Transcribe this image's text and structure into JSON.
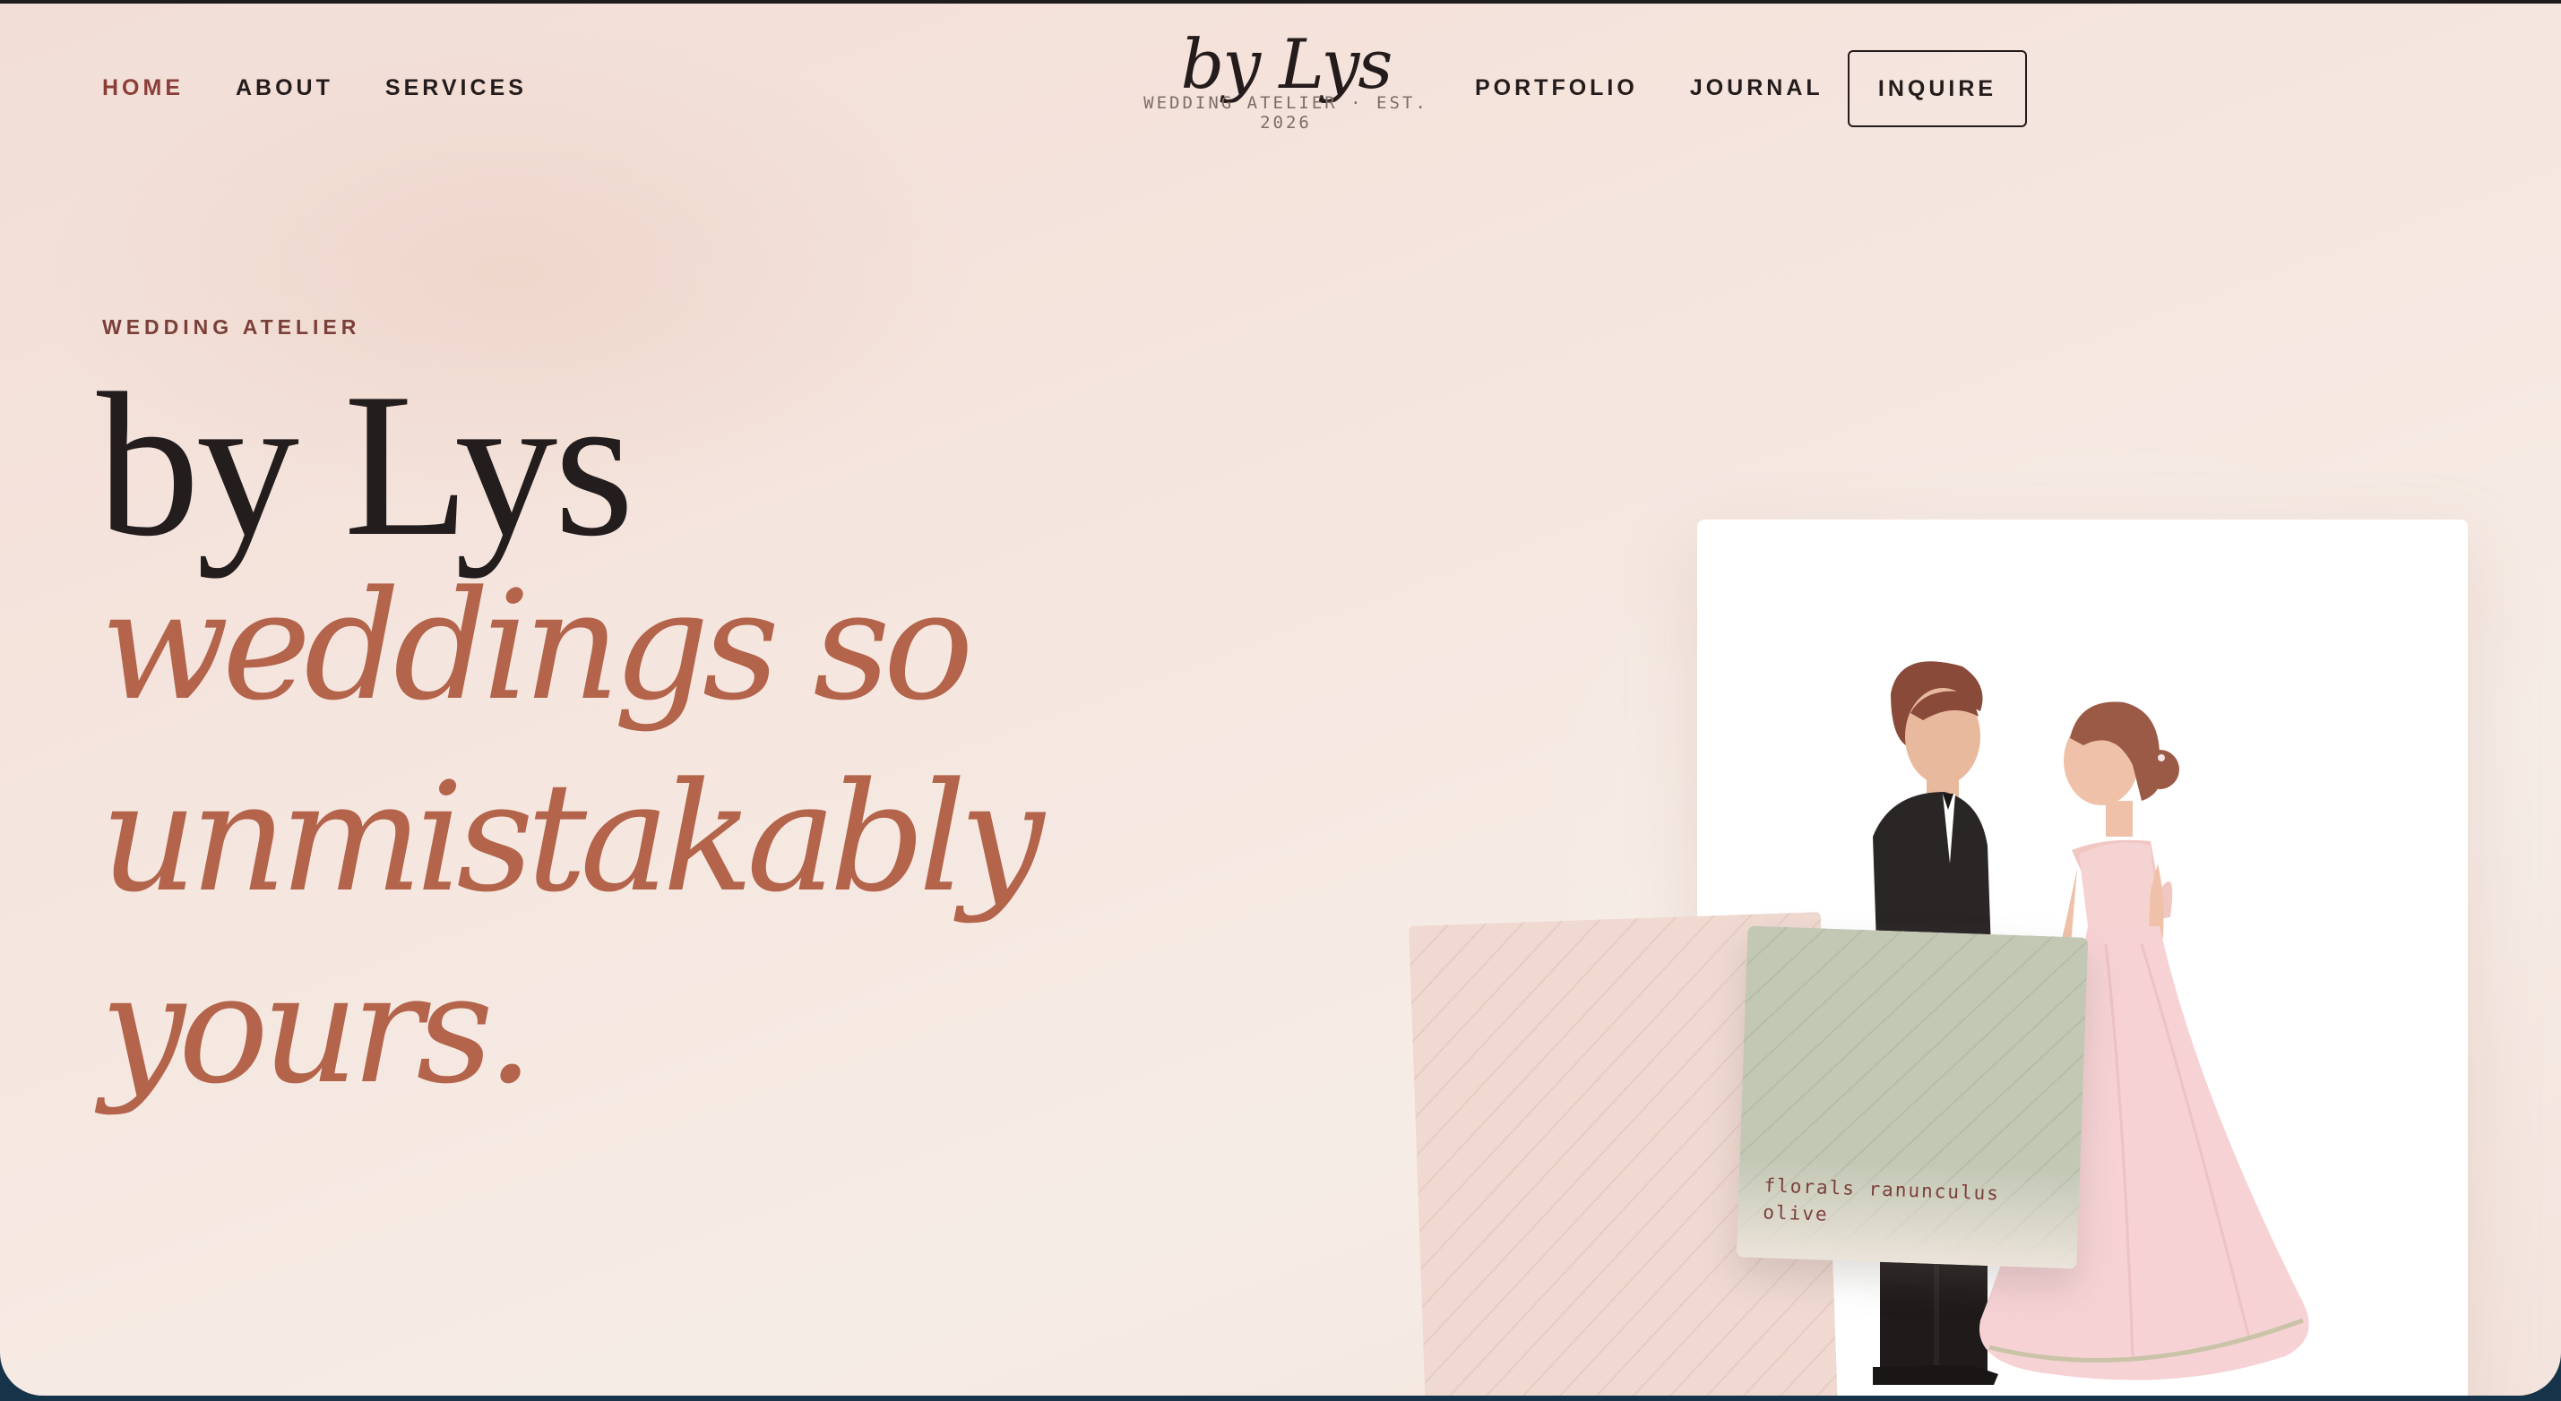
{
  "nav": {
    "left": [
      "HOME",
      "ABOUT",
      "SERVICES"
    ],
    "right": [
      "PORTFOLIO",
      "JOURNAL"
    ],
    "active": "HOME",
    "cta_label": "INQUIRE"
  },
  "brand": {
    "script": "by Lys",
    "subtitle": "WEDDING ATELIER · EST. 2026"
  },
  "hero": {
    "eyebrow": "WEDDING ATELIER",
    "headline": "by Lys",
    "tagline_lines": [
      "weddings so",
      "unmistakably",
      "yours."
    ]
  },
  "swatch": {
    "label": "florals ranunculus olive"
  },
  "colors": {
    "accent": "#b3644b",
    "ink": "#231d1d",
    "active_link": "#8a3e37",
    "sage": "#c3c8b5",
    "blush": "#f2ded6"
  },
  "icons": [
    "couple-illustration-icon"
  ]
}
